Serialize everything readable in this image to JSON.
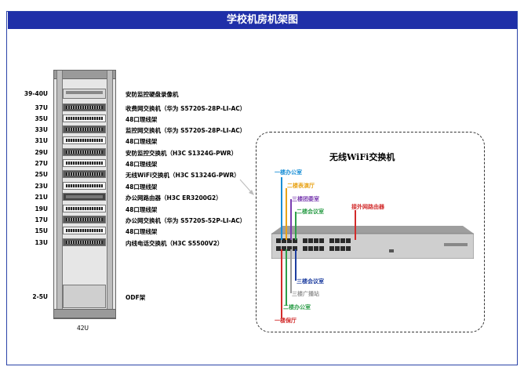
{
  "title": "学校机房机架图",
  "rack": {
    "size_label": "42U",
    "units": [
      {
        "u": "39-40U",
        "label": "安防监控硬盘录像机"
      },
      {
        "u": "37U",
        "label": "收费网交换机（华为 S5720S-28P-LI-AC）"
      },
      {
        "u": "35U",
        "label": "48口理线架"
      },
      {
        "u": "33U",
        "label": "监控网交换机（华为 S5720S-28P-LI-AC）"
      },
      {
        "u": "31U",
        "label": "48口理线架"
      },
      {
        "u": "29U",
        "label": "安防监控交换机（H3C S1324G-PWR）"
      },
      {
        "u": "27U",
        "label": "48口理线架"
      },
      {
        "u": "25U",
        "label": "无线WiFi交换机（H3C S1324G-PWR）"
      },
      {
        "u": "23U",
        "label": "48口理线架"
      },
      {
        "u": "21U",
        "label": "办公网路由器（H3C ER3200G2）"
      },
      {
        "u": "19U",
        "label": "48口理线架"
      },
      {
        "u": "17U",
        "label": "办公网交换机（华为 S5720S-52P-LI-AC）"
      },
      {
        "u": "15U",
        "label": "48口理线架"
      },
      {
        "u": "13U",
        "label": "内线电话交换机（H3C S5500V2）"
      },
      {
        "u": "2-5U",
        "label": "ODF架"
      }
    ]
  },
  "wifi_switch": {
    "title": "无线WiFi交换机",
    "upper_labels": [
      {
        "text": "一楼办公室",
        "color": "#1a8fd6"
      },
      {
        "text": "二楼表演厅",
        "color": "#e8a317"
      },
      {
        "text": "三楼团委室",
        "color": "#7a3db0"
      },
      {
        "text": "二楼会议室",
        "color": "#2e9e4a"
      },
      {
        "text": "接外网路由器",
        "color": "#d22b2b"
      }
    ],
    "lower_labels": [
      {
        "text": "三楼会议室",
        "color": "#1f3fa0"
      },
      {
        "text": "三楼广播站",
        "color": "#9a9a9a"
      },
      {
        "text": "二楼办公室",
        "color": "#2e9e4a"
      },
      {
        "text": "一楼保厅",
        "color": "#d22b2b"
      }
    ]
  }
}
